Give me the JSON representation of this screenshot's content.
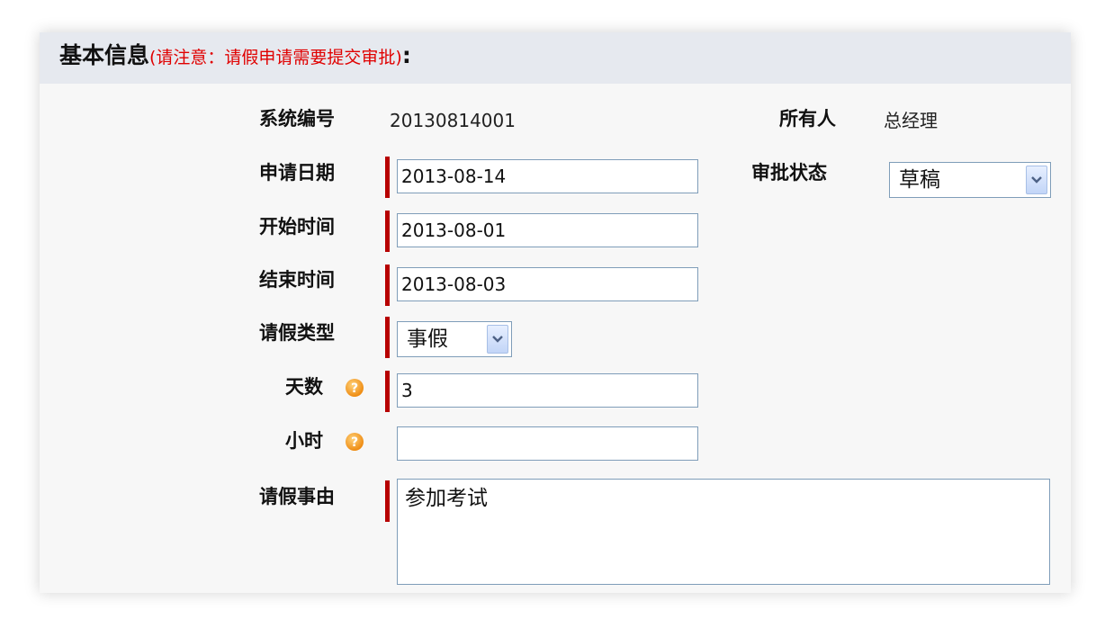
{
  "header": {
    "title": "基本信息",
    "note": "(请注意：请假申请需要提交审批)",
    "colon": ":"
  },
  "fields": {
    "system_no": {
      "label": "系统编号",
      "value": "20130814001"
    },
    "owner": {
      "label": "所有人",
      "value": "总经理"
    },
    "apply_date": {
      "label": "申请日期",
      "value": "2013-08-14"
    },
    "approval_status": {
      "label": "审批状态",
      "value": "草稿"
    },
    "start_time": {
      "label": "开始时间",
      "value": "2013-08-01"
    },
    "end_time": {
      "label": "结束时间",
      "value": "2013-08-03"
    },
    "leave_type": {
      "label": "请假类型",
      "value": "事假"
    },
    "days": {
      "label": "天数",
      "value": "3"
    },
    "hours": {
      "label": "小时",
      "value": ""
    },
    "reason": {
      "label": "请假事由",
      "value": "参加考试"
    }
  },
  "colors": {
    "required_marker": "#b70000",
    "header_bg": "#e6e9ef",
    "note_text": "#e00000",
    "help_icon": "#f39a1c"
  },
  "icons": {
    "help": "question-circle-icon",
    "dropdown": "chevron-down-icon"
  }
}
